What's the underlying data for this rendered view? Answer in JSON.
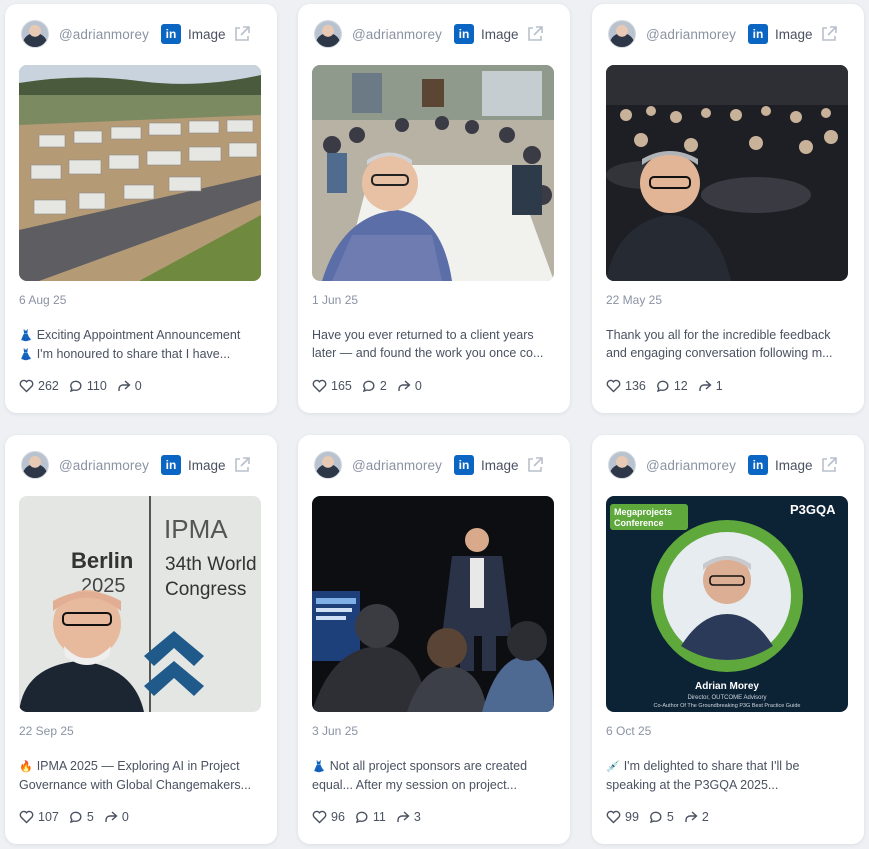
{
  "posts": [
    {
      "handle": "@adrianmorey",
      "network": "in",
      "type": "Image",
      "date": "6 Aug 25",
      "caption_line1": "Exciting Appointment Announcement",
      "caption_line2": "I'm honoured to share that I have...",
      "emoji1": "👗",
      "emoji2": "👗",
      "likes": "262",
      "comments": "110",
      "shares": "0",
      "media": "aerial-construction-site"
    },
    {
      "handle": "@adrianmorey",
      "network": "in",
      "type": "Image",
      "date": "1 Jun 25",
      "caption_line1": "Have you ever returned to a client years",
      "caption_line2": "later — and found the work you once co...",
      "likes": "165",
      "comments": "2",
      "shares": "0",
      "media": "meeting-room-selfie"
    },
    {
      "handle": "@adrianmorey",
      "network": "in",
      "type": "Image",
      "date": "22 May 25",
      "caption_line1": "Thank you all for the incredible feedback",
      "caption_line2": "and engaging conversation following m...",
      "likes": "136",
      "comments": "12",
      "shares": "1",
      "media": "conference-audience-selfie"
    },
    {
      "handle": "@adrianmorey",
      "network": "in",
      "type": "Image",
      "date": "22 Sep 25",
      "caption_line1": "IPMA 2025 — Exploring AI in Project",
      "caption_line2": "Governance with Global Changemakers...",
      "emoji1": "🔥",
      "likes": "107",
      "comments": "5",
      "shares": "0",
      "media": "ipma-berlin-selfie",
      "media_text": {
        "brand": "IPMA",
        "city": "Berlin",
        "year": "2025",
        "event1": "34th World",
        "event2": "Congress"
      }
    },
    {
      "handle": "@adrianmorey",
      "network": "in",
      "type": "Image",
      "date": "3 Jun 25",
      "caption_line1": "Not all project sponsors are created",
      "caption_line2": "equal... After my session on project...",
      "emoji1": "👗",
      "likes": "96",
      "comments": "11",
      "shares": "3",
      "media": "stage-presentation"
    },
    {
      "handle": "@adrianmorey",
      "network": "in",
      "type": "Image",
      "date": "6 Oct 25",
      "caption_line1": "I'm delighted to share that I'll be",
      "caption_line2": "speaking at the P3GQA 2025...",
      "emoji1": "💉",
      "likes": "99",
      "comments": "5",
      "shares": "2",
      "media": "megaprojects-speaker-card",
      "media_text": {
        "badge1": "Megaprojects",
        "badge2": "Conference",
        "brand": "P3GQA",
        "name": "Adrian Morey",
        "role": "Director, OUTCOME Advisory",
        "tagline": "Co-Author Of The Groundbreaking P3G Best Practice Guide"
      }
    }
  ],
  "colors": {
    "linkedin": "#0a66c2",
    "background": "#eef0f4",
    "card": "#ffffff",
    "muted_text": "#8a93a3"
  }
}
